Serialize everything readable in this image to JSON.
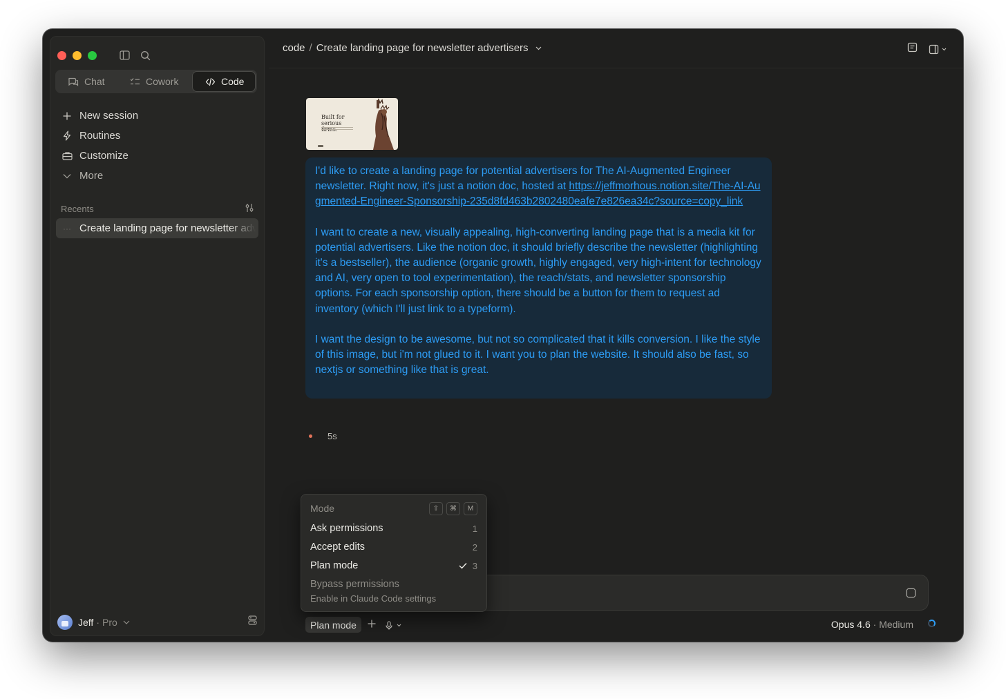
{
  "window": {
    "traffic_lights": [
      "#ff5f57",
      "#febc2e",
      "#28c840"
    ]
  },
  "sidebar": {
    "tabs": [
      {
        "label": "Chat",
        "icon": "chat-bubbles-icon",
        "active": false
      },
      {
        "label": "Cowork",
        "icon": "task-list-icon",
        "active": false
      },
      {
        "label": "Code",
        "icon": "code-brackets-icon",
        "active": true
      }
    ],
    "nav": [
      {
        "label": "New session",
        "icon": "plus-icon"
      },
      {
        "label": "Routines",
        "icon": "bolt-icon"
      },
      {
        "label": "Customize",
        "icon": "briefcase-icon"
      },
      {
        "label": "More",
        "icon": "chevron-down-icon"
      }
    ],
    "recents_label": "Recents",
    "recent_item": "Create landing page for newsletter advertisers",
    "recent_dots": "···",
    "user": {
      "name": "Jeff",
      "separator": "·",
      "plan": "Pro"
    }
  },
  "header": {
    "project": "code",
    "separator": "/",
    "title": "Create landing page for newsletter advertisers"
  },
  "thumbnail": {
    "headline": "Built for serious firms."
  },
  "message": {
    "p1_text": "I'd like to create a landing page for potential advertisers for The AI-Augmented Engineer newsletter. Right now, it's just a notion doc, hosted at ",
    "p1_link": "https://jeffmorhous.notion.site/The-AI-Augmented-Engineer-Sponsorship-235d8fd463b2802480eafe7e826ea34c?source=copy_link",
    "p2": "I want to create a new, visually appealing, high-converting landing page that is a media kit for potential advertisers. Like the notion doc, it should briefly describe the newsletter (highlighting it's a bestseller), the audience (organic growth, highly engaged, very high-intent for technology and AI, very open to tool experimentation), the reach/stats, and newsletter sponsorship options. For each sponsorship option, there should be a button for them to request ad inventory (which I'll just link to a typeform).",
    "p3": "I want the design to be awesome, but not so complicated that it kills conversion. I like the style of this image, but i'm not glued to it. I want you to plan the website. It should also be fast, so nextjs or something like that is great."
  },
  "status": {
    "elapsed": "5s",
    "dot_color": "#e2735a"
  },
  "mode_menu": {
    "header": "Mode",
    "shortcut_keys": [
      "⇧",
      "⌘",
      "M"
    ],
    "items": [
      {
        "label": "Ask permissions",
        "key": "1",
        "checked": false
      },
      {
        "label": "Accept edits",
        "key": "2",
        "checked": false
      },
      {
        "label": "Plan mode",
        "key": "3",
        "checked": true
      },
      {
        "label": "Bypass permissions",
        "key": "",
        "checked": false
      }
    ],
    "bypass_note": "Enable in Claude Code settings"
  },
  "composer": {
    "mode_button": "Plan mode",
    "model": "Opus 4.6",
    "effort": "· Medium"
  },
  "colors": {
    "accent": "#2d9cf4",
    "bubble_bg": "#172a3a",
    "window_bg": "#1f1f1e"
  }
}
